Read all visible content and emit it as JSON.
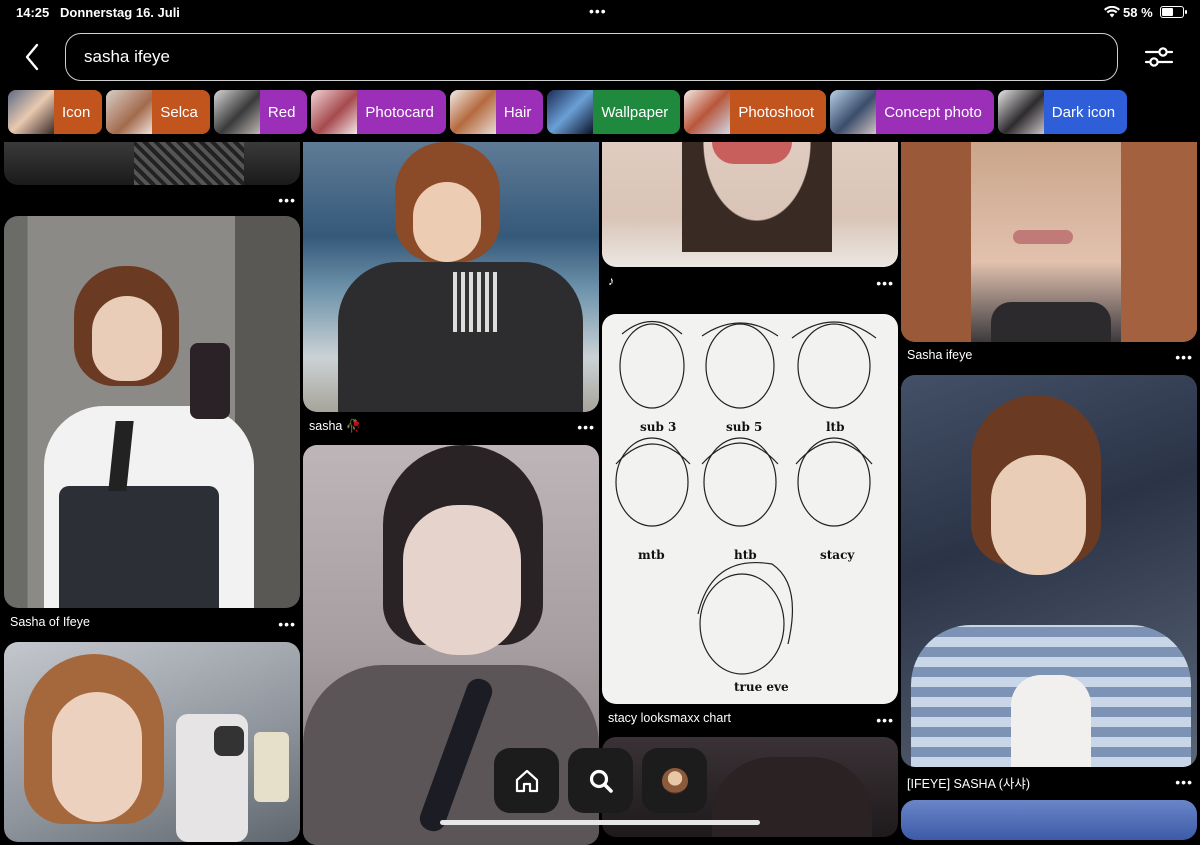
{
  "status_bar": {
    "time": "14:25",
    "date": "Donnerstag 16. Juli",
    "dots": "•••",
    "battery": "58 %",
    "battery_level": 0.58
  },
  "search": {
    "query": "sasha ifeye"
  },
  "chips": [
    {
      "label": "Icon",
      "color": "#c2541e"
    },
    {
      "label": "Selca",
      "color": "#c2541e"
    },
    {
      "label": "Red",
      "color": "#9b2fb8"
    },
    {
      "label": "Photocard",
      "color": "#9b2fb8"
    },
    {
      "label": "Hair",
      "color": "#9b2fb8"
    },
    {
      "label": "Wallpaper",
      "color": "#1f8a3e"
    },
    {
      "label": "Photoshoot",
      "color": "#c2541e"
    },
    {
      "label": "Concept photo",
      "color": "#9b2fb8"
    },
    {
      "label": "Dark icon",
      "color": "#2e5fd8"
    }
  ],
  "pins": {
    "col1": [
      {
        "caption": ""
      },
      {
        "caption": "Sasha of Ifeye"
      },
      {
        "caption": ""
      }
    ],
    "col2": [
      {
        "caption": "sasha 🥀"
      },
      {
        "caption": ""
      }
    ],
    "col3": [
      {
        "caption": "♪"
      },
      {
        "caption": "stacy looksmaxx chart",
        "labels": [
          "sub 3",
          "sub 5",
          "ltb",
          "mtb",
          "htb",
          "stacy",
          "true eve"
        ]
      },
      {
        "caption": ""
      }
    ],
    "col4": [
      {
        "caption": "Sasha ifeye"
      },
      {
        "caption": "[IFEYE] SASHA (사샤)"
      },
      {
        "caption": ""
      }
    ]
  },
  "more_label": "•••",
  "nav": {
    "home": "home-icon",
    "search": "search-icon",
    "profile": "avatar"
  }
}
